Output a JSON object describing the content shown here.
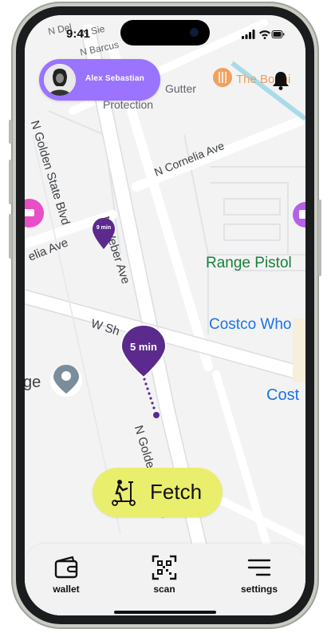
{
  "status_bar": {
    "time": "9:41"
  },
  "profile": {
    "name": "Alex Sebastian"
  },
  "map": {
    "street_labels": [
      "N Golden State Blvd",
      "N Weber Ave",
      "N Cornelia Ave",
      "W Sh",
      "N Golden State Bl",
      "elia Ave",
      "N Barcus",
      "N Del",
      "N Sie",
      "Gutter",
      "Protection"
    ],
    "places": [
      {
        "name": "The Bonni"
      },
      {
        "name": "Range Pistol"
      },
      {
        "name": "Costco Who"
      },
      {
        "name": "Cost"
      },
      {
        "name": "ge"
      }
    ],
    "pins": [
      {
        "label": "9 min"
      },
      {
        "label": "5 min"
      }
    ]
  },
  "fetch_button": {
    "label": "Fetch"
  },
  "tabs": [
    {
      "label": "wallet",
      "icon": "wallet-icon"
    },
    {
      "label": "scan",
      "icon": "qr-scan-icon"
    },
    {
      "label": "settings",
      "icon": "menu-icon"
    }
  ],
  "colors": {
    "accent_purple": "#5b2a8c",
    "profile_pill": "#9a73ff",
    "fetch_yellow": "#e9ee6d",
    "map_place_blue": "#1a73e8",
    "map_place_green": "#188038"
  }
}
